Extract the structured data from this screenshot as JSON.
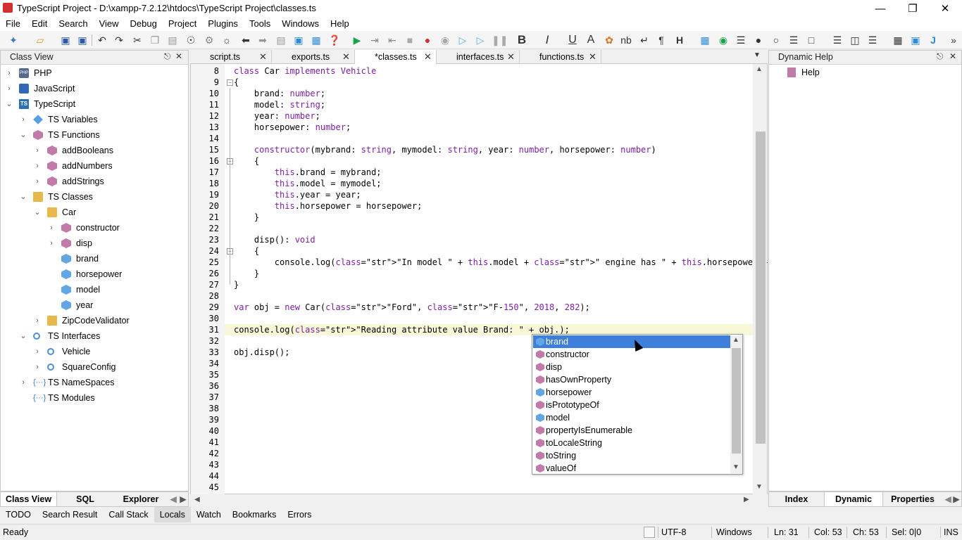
{
  "window": {
    "title": "TypeScript Project - D:\\xampp-7.2.12\\htdocs\\TypeScript Project\\classes.ts"
  },
  "menu": [
    "File",
    "Edit",
    "Search",
    "View",
    "Debug",
    "Project",
    "Plugins",
    "Tools",
    "Windows",
    "Help"
  ],
  "left_panel": {
    "title": "Class View",
    "tree": [
      {
        "label": "PHP",
        "icon": "php-icon",
        "arrow": "›"
      },
      {
        "label": "JavaScript",
        "icon": "js-icon",
        "arrow": "›"
      },
      {
        "label": "TypeScript",
        "icon": "ts-icon",
        "arrow": "⌄"
      },
      {
        "label": "TS Variables",
        "icon": "variable-icon",
        "arrow": "›"
      },
      {
        "label": "TS Functions",
        "icon": "function-icon",
        "arrow": "⌄"
      },
      {
        "label": "addBooleans",
        "icon": "function-icon",
        "arrow": "›"
      },
      {
        "label": "addNumbers",
        "icon": "function-icon",
        "arrow": "›"
      },
      {
        "label": "addStrings",
        "icon": "function-icon",
        "arrow": "›"
      },
      {
        "label": "TS Classes",
        "icon": "class-icon",
        "arrow": "⌄"
      },
      {
        "label": "Car",
        "icon": "class-icon",
        "arrow": "⌄"
      },
      {
        "label": "constructor",
        "icon": "function-icon",
        "arrow": "›"
      },
      {
        "label": "disp",
        "icon": "function-icon",
        "arrow": "›"
      },
      {
        "label": "brand",
        "icon": "property-icon",
        "arrow": ""
      },
      {
        "label": "horsepower",
        "icon": "property-icon",
        "arrow": ""
      },
      {
        "label": "model",
        "icon": "property-icon",
        "arrow": ""
      },
      {
        "label": "year",
        "icon": "property-icon",
        "arrow": ""
      },
      {
        "label": "ZipCodeValidator",
        "icon": "class-icon",
        "arrow": "›"
      },
      {
        "label": "TS Interfaces",
        "icon": "interface-icon",
        "arrow": "⌄"
      },
      {
        "label": "Vehicle",
        "icon": "interface-icon",
        "arrow": "›"
      },
      {
        "label": "SquareConfig",
        "icon": "interface-icon",
        "arrow": "›"
      },
      {
        "label": "TS NameSpaces",
        "icon": "namespace-icon",
        "arrow": "›"
      },
      {
        "label": "TS Modules",
        "icon": "namespace-icon",
        "arrow": ""
      }
    ],
    "bottom_tabs": [
      "Class View",
      "SQL",
      "Explorer"
    ]
  },
  "editor": {
    "tabs": [
      {
        "label": "script.ts",
        "active": false
      },
      {
        "label": "exports.ts",
        "active": false
      },
      {
        "label": "*classes.ts",
        "active": true
      },
      {
        "label": "interfaces.ts",
        "active": false
      },
      {
        "label": "functions.ts",
        "active": false
      }
    ],
    "lines": [
      {
        "n": "8",
        "text": "class Car implements Vehicle"
      },
      {
        "n": "9",
        "text": "{"
      },
      {
        "n": "10",
        "text": "    brand: number;"
      },
      {
        "n": "11",
        "text": "    model: string;"
      },
      {
        "n": "12",
        "text": "    year: number;"
      },
      {
        "n": "13",
        "text": "    horsepower: number;"
      },
      {
        "n": "14",
        "text": ""
      },
      {
        "n": "15",
        "text": "    constructor(mybrand: string, mymodel: string, year: number, horsepower: number)"
      },
      {
        "n": "16",
        "text": "    {"
      },
      {
        "n": "17",
        "text": "        this.brand = mybrand;"
      },
      {
        "n": "18",
        "text": "        this.model = mymodel;"
      },
      {
        "n": "19",
        "text": "        this.year = year;"
      },
      {
        "n": "20",
        "text": "        this.horsepower = horsepower;"
      },
      {
        "n": "21",
        "text": "    }"
      },
      {
        "n": "22",
        "text": ""
      },
      {
        "n": "23",
        "text": "    disp(): void"
      },
      {
        "n": "24",
        "text": "    {"
      },
      {
        "n": "25",
        "text": "        console.log(\"In model \" + this.model + \" engine has \" + this.horsepower + \" hp.\");"
      },
      {
        "n": "26",
        "text": "    }"
      },
      {
        "n": "27",
        "text": "}"
      },
      {
        "n": "28",
        "text": ""
      },
      {
        "n": "29",
        "text": "var obj = new Car(\"Ford\", \"F-150\", 2018, 282);"
      },
      {
        "n": "30",
        "text": ""
      },
      {
        "n": "31",
        "text": "console.log(\"Reading attribute value Brand: \" + obj.);"
      },
      {
        "n": "32",
        "text": ""
      },
      {
        "n": "33",
        "text": "obj.disp();"
      },
      {
        "n": "34",
        "text": ""
      },
      {
        "n": "35",
        "text": ""
      },
      {
        "n": "36",
        "text": ""
      },
      {
        "n": "37",
        "text": ""
      },
      {
        "n": "38",
        "text": ""
      },
      {
        "n": "39",
        "text": ""
      },
      {
        "n": "40",
        "text": ""
      },
      {
        "n": "41",
        "text": ""
      },
      {
        "n": "42",
        "text": ""
      },
      {
        "n": "43",
        "text": ""
      },
      {
        "n": "44",
        "text": ""
      },
      {
        "n": "45",
        "text": ""
      }
    ],
    "autocomplete": [
      {
        "label": "brand",
        "icon": "property-icon",
        "selected": true
      },
      {
        "label": "constructor",
        "icon": "function-icon"
      },
      {
        "label": "disp",
        "icon": "function-icon"
      },
      {
        "label": "hasOwnProperty",
        "icon": "function-icon"
      },
      {
        "label": "horsepower",
        "icon": "property-icon"
      },
      {
        "label": "isPrototypeOf",
        "icon": "function-icon"
      },
      {
        "label": "model",
        "icon": "property-icon"
      },
      {
        "label": "propertyIsEnumerable",
        "icon": "function-icon"
      },
      {
        "label": "toLocaleString",
        "icon": "function-icon"
      },
      {
        "label": "toString",
        "icon": "function-icon"
      },
      {
        "label": "valueOf",
        "icon": "function-icon"
      }
    ]
  },
  "right_panel": {
    "title": "Dynamic Help",
    "items": [
      "Help"
    ],
    "bottom_tabs": [
      "Index",
      "Dynamic Help",
      "Properties"
    ]
  },
  "output_tabs": [
    "TODO",
    "Search Result",
    "Call Stack",
    "Locals",
    "Watch",
    "Bookmarks",
    "Errors"
  ],
  "status": {
    "ready": "Ready",
    "encoding": "UTF-8",
    "line_ending": "Windows",
    "line": "Ln: 31",
    "col": "Col: 53",
    "ch": "Ch: 53",
    "sel": "Sel: 0|0",
    "mode": "INS"
  },
  "colors": {
    "accent": "#3f7fdc",
    "keyword": "#7b1fa2",
    "current_line": "#f8f8d8"
  }
}
